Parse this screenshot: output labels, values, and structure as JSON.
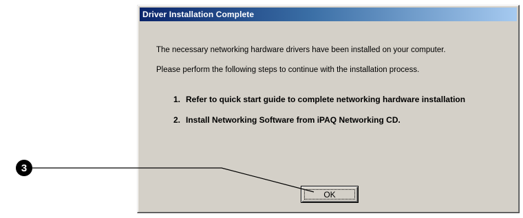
{
  "dialog": {
    "title": "Driver Installation Complete",
    "message_1": "The necessary networking hardware drivers have been installed on your computer.",
    "message_2": "Please perform the following steps to continue with the installation process.",
    "steps": [
      {
        "number": "1.",
        "text": "Refer to quick start guide to complete networking hardware installation"
      },
      {
        "number": "2.",
        "text": "Install Networking Software from iPAQ Networking CD."
      }
    ],
    "ok_label": "OK"
  },
  "callout": {
    "number": "3"
  },
  "colors": {
    "dialog_face": "#d4d0c8",
    "titlebar_start": "#0a246a",
    "titlebar_end": "#a6caf0",
    "title_text": "#ffffff"
  }
}
